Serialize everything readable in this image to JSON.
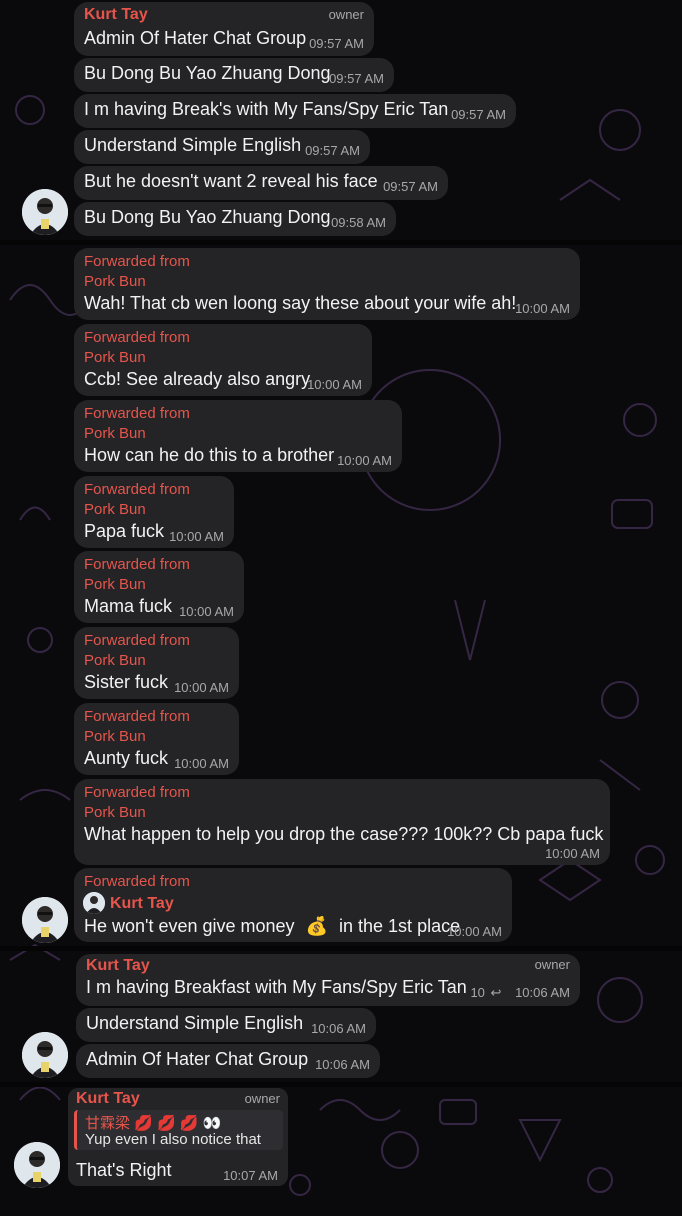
{
  "group1": {
    "sender": "Kurt Tay",
    "role": "owner",
    "messages": [
      {
        "text": "Admin Of Hater Chat Group",
        "time": "09:57 AM"
      },
      {
        "text": "Bu Dong Bu Yao Zhuang Dong",
        "time": "09:57 AM"
      },
      {
        "text": "I m having Break's with My Fans/Spy Eric Tan",
        "time": "09:57 AM"
      },
      {
        "text": "Understand Simple English",
        "time": "09:57 AM"
      },
      {
        "text": "But he doesn't want 2 reveal his face",
        "time": "09:57 AM"
      },
      {
        "text": "Bu Dong Bu Yao Zhuang Dong",
        "time": "09:58 AM"
      }
    ]
  },
  "group2": {
    "forwarded_label": "Forwarded from",
    "forward_source": "Pork Bun",
    "messages": [
      {
        "text": "Wah! That cb wen loong say these about your wife ah!",
        "time": "10:00 AM"
      },
      {
        "text": "Ccb! See already also angry",
        "time": "10:00 AM"
      },
      {
        "text": "How can he do this to a brother",
        "time": "10:00 AM"
      },
      {
        "text": "Papa fuck",
        "time": "10:00 AM"
      },
      {
        "text": "Mama fuck",
        "time": "10:00 AM"
      },
      {
        "text": "Sister fuck",
        "time": "10:00 AM"
      },
      {
        "text": "Aunty fuck",
        "time": "10:00 AM"
      },
      {
        "text": "What happen to help you drop the case??? 100k?? Cb papa fuck",
        "time": "10:00 AM"
      }
    ],
    "last": {
      "forwarded_label": "Forwarded from",
      "source": "Kurt Tay",
      "text_before": "He won't even give money",
      "emoji": "💰",
      "text_after": "in the 1st place",
      "time": "10:00 AM"
    }
  },
  "group3": {
    "sender": "Kurt Tay",
    "role": "owner",
    "messages": [
      {
        "text": "I m having Breakfast with My Fans/Spy Eric Tan",
        "time": "10:06 AM",
        "replies": "10"
      },
      {
        "text": "Understand Simple English",
        "time": "10:06 AM"
      },
      {
        "text": "Admin Of Hater Chat Group",
        "time": "10:06 AM"
      }
    ]
  },
  "group4": {
    "sender": "Kurt Tay",
    "role": "owner",
    "reply_name": "甘霖梁 💋 💋 💋 👀",
    "reply_text": "Yup even I also notice that",
    "text": "That's Right",
    "time": "10:07 AM"
  },
  "colors": {
    "background": "#0a0a0d",
    "bubble": "#242427",
    "accent_name": "#e5554b",
    "timestamp": "#a8a8ab"
  }
}
